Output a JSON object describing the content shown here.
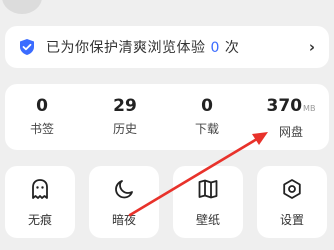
{
  "protect": {
    "prefix": "已为你保护清爽浏览体验",
    "count": "0",
    "suffix": "次",
    "icon": "shield-check-icon",
    "chevron": "›"
  },
  "stats": [
    {
      "value": "0",
      "unit": "",
      "label": "书签"
    },
    {
      "value": "29",
      "unit": "",
      "label": "历史"
    },
    {
      "value": "0",
      "unit": "",
      "label": "下载"
    },
    {
      "value": "370",
      "unit": "MB",
      "label": "网盘"
    }
  ],
  "tiles": [
    {
      "label": "无痕",
      "icon": "ghost-icon"
    },
    {
      "label": "暗夜",
      "icon": "moon-icon"
    },
    {
      "label": "壁纸",
      "icon": "book-icon"
    },
    {
      "label": "设置",
      "icon": "gear-icon"
    }
  ],
  "colors": {
    "accent": "#3b6cff",
    "annotation_arrow": "#e8322b"
  }
}
